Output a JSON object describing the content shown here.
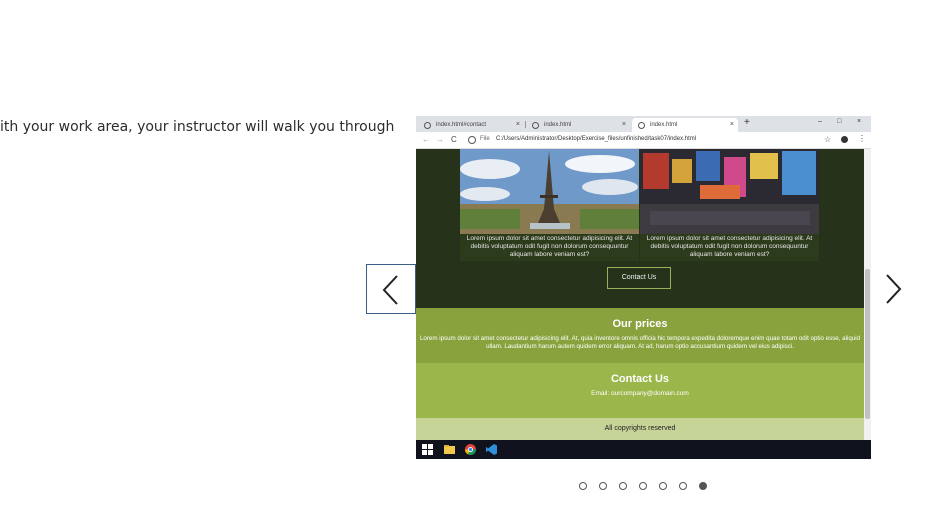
{
  "intro_text": "ith your work area, your instructor will walk you through",
  "browser": {
    "tabs": [
      {
        "label": "index.html#contact",
        "close": "×"
      },
      {
        "label": "index.html",
        "close": "×"
      },
      {
        "label": "index.html",
        "close": "×"
      }
    ],
    "new_tab": "+",
    "window_controls": {
      "minimize": "–",
      "maximize": "□",
      "close": "×"
    },
    "nav": {
      "back": "←",
      "forward": "→",
      "reload": "C"
    },
    "address": {
      "scheme": "File",
      "url": "C:/Users/Administrator/Desktop/Exercise_files/unfinished/task07/index.html"
    },
    "star": "☆",
    "menu": "⋮"
  },
  "page": {
    "cards": [
      {
        "caption": "Lorem ipsum dolor sit amet consectetur adipisicing elit. At debitis voluptatum odit fugit non dolorum consequuntur aliquam labore veniam est?"
      },
      {
        "caption": "Lorem ipsum dolor sit amet consectetur adipisicing elit. At debitis voluptatum odit fugit non dolorum consequuntur aliquam labore veniam est?"
      }
    ],
    "contact_button": "Contact Us",
    "prices": {
      "heading": "Our prices",
      "text": "Lorem ipsum dolor sit amet consectetur adipisicing elit. At, quia inventore omnis officia hic tempora expedita doloremque enim quae totam odit optio esse, aliquid ullam. Laudantium harum autem quidem error aliquam. At ad, harum optio accusantium quidem vel eius adipisci."
    },
    "contact": {
      "heading": "Contact Us",
      "email": "Email: ourcompany@domain.com"
    },
    "footer": "All copyrights reserved"
  },
  "taskbar_icons": [
    "windows-icon",
    "file-explorer-icon",
    "chrome-icon",
    "vscode-icon"
  ],
  "carousel": {
    "slide_count": 7,
    "active_index": 6
  },
  "colors": {
    "dark_section": "#26331a",
    "prices_bg": "#8aa23e",
    "contact_bg": "#9bb64a",
    "footer_bg": "#c6d497",
    "nav_border": "#3b5f86"
  }
}
